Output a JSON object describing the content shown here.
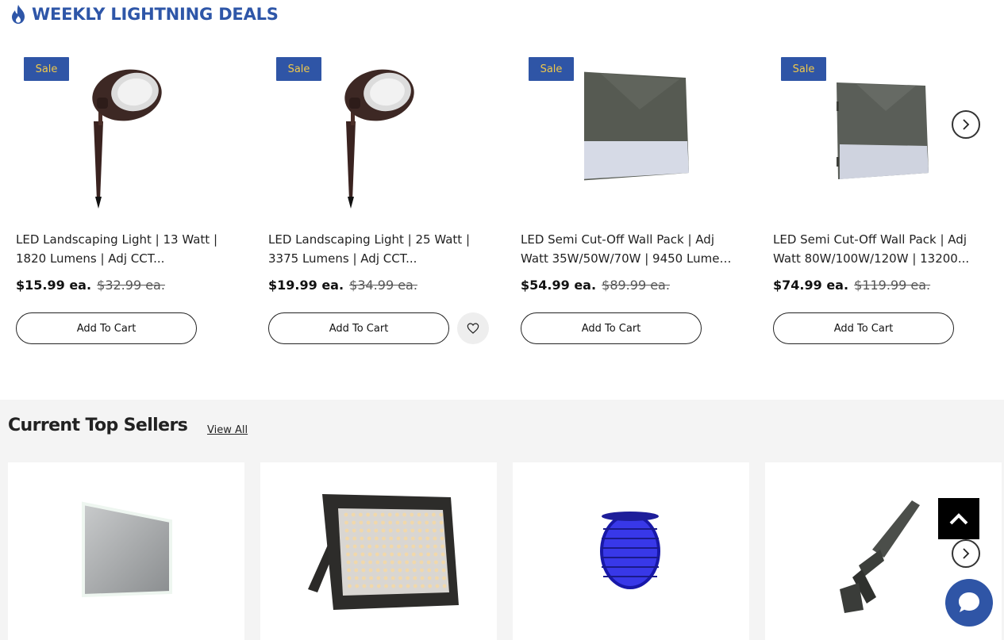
{
  "deals": {
    "title": "WEEKLY LIGHTNING DEALS",
    "products": [
      {
        "badge": "Sale",
        "name_line1": "LED Landscaping Light | 13 Watt |",
        "name_line2": "1820 Lumens | Adj CCT...",
        "price": "$15.99 ea.",
        "old_price": "$32.99 ea.",
        "button": "Add To Cart",
        "image": "landscape-spot-light"
      },
      {
        "badge": "Sale",
        "name_line1": "LED Landscaping Light | 25 Watt |",
        "name_line2": "3375 Lumens | Adj CCT...",
        "price": "$19.99 ea.",
        "old_price": "$34.99 ea.",
        "button": "Add To Cart",
        "image": "landscape-spot-light",
        "wishlist_icon": "heart-icon"
      },
      {
        "badge": "Sale",
        "name_line1": "LED Semi Cut-Off Wall Pack | Adj",
        "name_line2": "Watt 35W/50W/70W | 9450 Lumen...",
        "price": "$54.99 ea.",
        "old_price": "$89.99 ea.",
        "button": "Add To Cart",
        "image": "wall-pack-light"
      },
      {
        "badge": "Sale",
        "name_line1": "LED Semi Cut-Off Wall Pack | Adj",
        "name_line2": "Watt 80W/100W/120W | 13200...",
        "price": "$74.99 ea.",
        "old_price": "$119.99 ea.",
        "button": "Add To Cart",
        "image": "wall-pack-light"
      }
    ],
    "next_icon": "chevron-right-icon"
  },
  "sellers": {
    "title": "Current Top Sellers",
    "view_all": "View All",
    "items": [
      "led-mirror",
      "flood-light",
      "blue-neon-strip-reel",
      "area-shoebox-light"
    ],
    "next_icon": "chevron-right-icon"
  },
  "widgets": {
    "back_to_top_icon": "chevron-up-icon",
    "chat_icon": "chat-bubble-icon"
  },
  "colors": {
    "brand_blue": "#2f55a6",
    "sale_text": "#f0c84a",
    "section_bg": "#f4f4f4"
  }
}
